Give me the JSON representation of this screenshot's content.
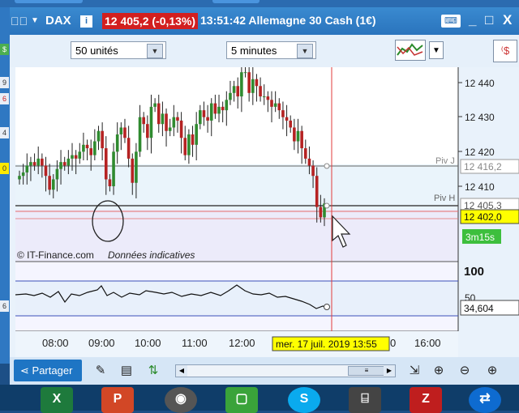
{
  "window": {
    "symbol": "DAX",
    "price_badge": "12 405,2 (-0,13%)",
    "time_title": "13:51:42 Allemagne 30 Cash (1€)",
    "info_icon": "i",
    "keyboard_icon": "keyboard-icon",
    "buttons": [
      "_",
      "□",
      "X"
    ]
  },
  "toolbar": {
    "units_select": "50 unités",
    "interval_select": "5 minutes"
  },
  "chart": {
    "price_axis_ticks": [
      "12 440",
      "12 430",
      "12 420",
      "12 410",
      "100",
      "50"
    ],
    "piv_j_label": "Piv J",
    "piv_j_value": "12 416,2",
    "piv_h_label": "Piv H",
    "piv_h_value": "12 405,3",
    "current_price": "12 402,0",
    "countdown": "3m15s",
    "osc_value": "34,604",
    "watermark_left": "© IT-Finance.com",
    "watermark_right": "Données indicatives",
    "time_ticks": [
      "08:00",
      "09:00",
      "10:00",
      "11:00",
      "12:00",
      "0",
      "16:00"
    ],
    "cursor_date": "mer. 17 juil. 2019 13:55",
    "colors": {
      "up": "#2f8a2f",
      "down": "#b52222",
      "cursor": "#e23b3b",
      "badge": "#d21f1f",
      "countdown_bg": "#3dbf3d",
      "price_label_bg": "#ffff00"
    }
  },
  "chart_data": {
    "type": "candlestick",
    "price_ticks": [
      12440,
      12430,
      12420,
      12410
    ],
    "osc_ticks": [
      100,
      50
    ],
    "piv_j": 12416.2,
    "piv_h": 12405.3,
    "last": 12402.0,
    "oscillator_last": 34.604
  },
  "bottombar": {
    "share_label": "Partager"
  },
  "taskbar": {
    "apps": [
      "excel-icon",
      "powerpoint-icon",
      "media-icon",
      "green-app-icon",
      "skype-icon",
      "network-icon",
      "filezilla-icon",
      "teamviewer-icon"
    ]
  }
}
